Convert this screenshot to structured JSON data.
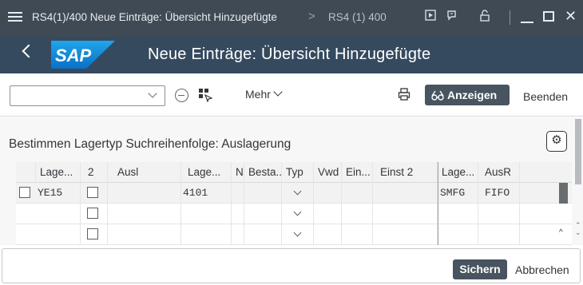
{
  "titlebar": {
    "title": "RS4(1)/400 Neue Einträge: Übersicht Hinzugefügte",
    "separator": ">",
    "system": "RS4 (1) 400",
    "icons": [
      "menu-icon",
      "play-icon",
      "customize-icon",
      "lock-icon",
      "minimize-icon",
      "maximize-icon",
      "close-icon"
    ]
  },
  "shell": {
    "logo_text": "SAP",
    "title": "Neue Einträge: Übersicht Hinzugefügte"
  },
  "toolbar": {
    "combo_value": "",
    "more_label": "Mehr",
    "display_label": "Anzeigen",
    "exit_label": "Beenden"
  },
  "section": {
    "title": "Bestimmen Lagertyp Suchreihenfolge: Auslagerung"
  },
  "table": {
    "columns": [
      "Lage...",
      "2",
      "Ausl",
      "Lage...",
      "N",
      "Besta...",
      "Typ",
      "Vwd",
      "Ein...",
      "Einst 2",
      "Lage...",
      "AusR"
    ],
    "rows": [
      {
        "selected": false,
        "c0": "YE15",
        "c2": "",
        "c3": "4101",
        "c4": "",
        "c5": "",
        "c7": "",
        "c8": "",
        "c9": "",
        "c10": "SMFG",
        "c11": "FIFO"
      },
      {
        "selected": false,
        "c0": "",
        "c2": "",
        "c3": "",
        "c4": "",
        "c5": "",
        "c7": "",
        "c8": "",
        "c9": "",
        "c10": "",
        "c11": ""
      },
      {
        "selected": false,
        "c0": "",
        "c2": "",
        "c3": "",
        "c4": "",
        "c5": "",
        "c7": "",
        "c8": "",
        "c9": "",
        "c10": "",
        "c11": ""
      }
    ]
  },
  "footer": {
    "save_label": "Sichern",
    "cancel_label": "Abbrechen"
  },
  "colors": {
    "titlebar_bg": "#3f4a55",
    "shell_bg": "#354a5f",
    "emphasized_button": "#48545f",
    "content_bg": "#f7f7f7"
  }
}
